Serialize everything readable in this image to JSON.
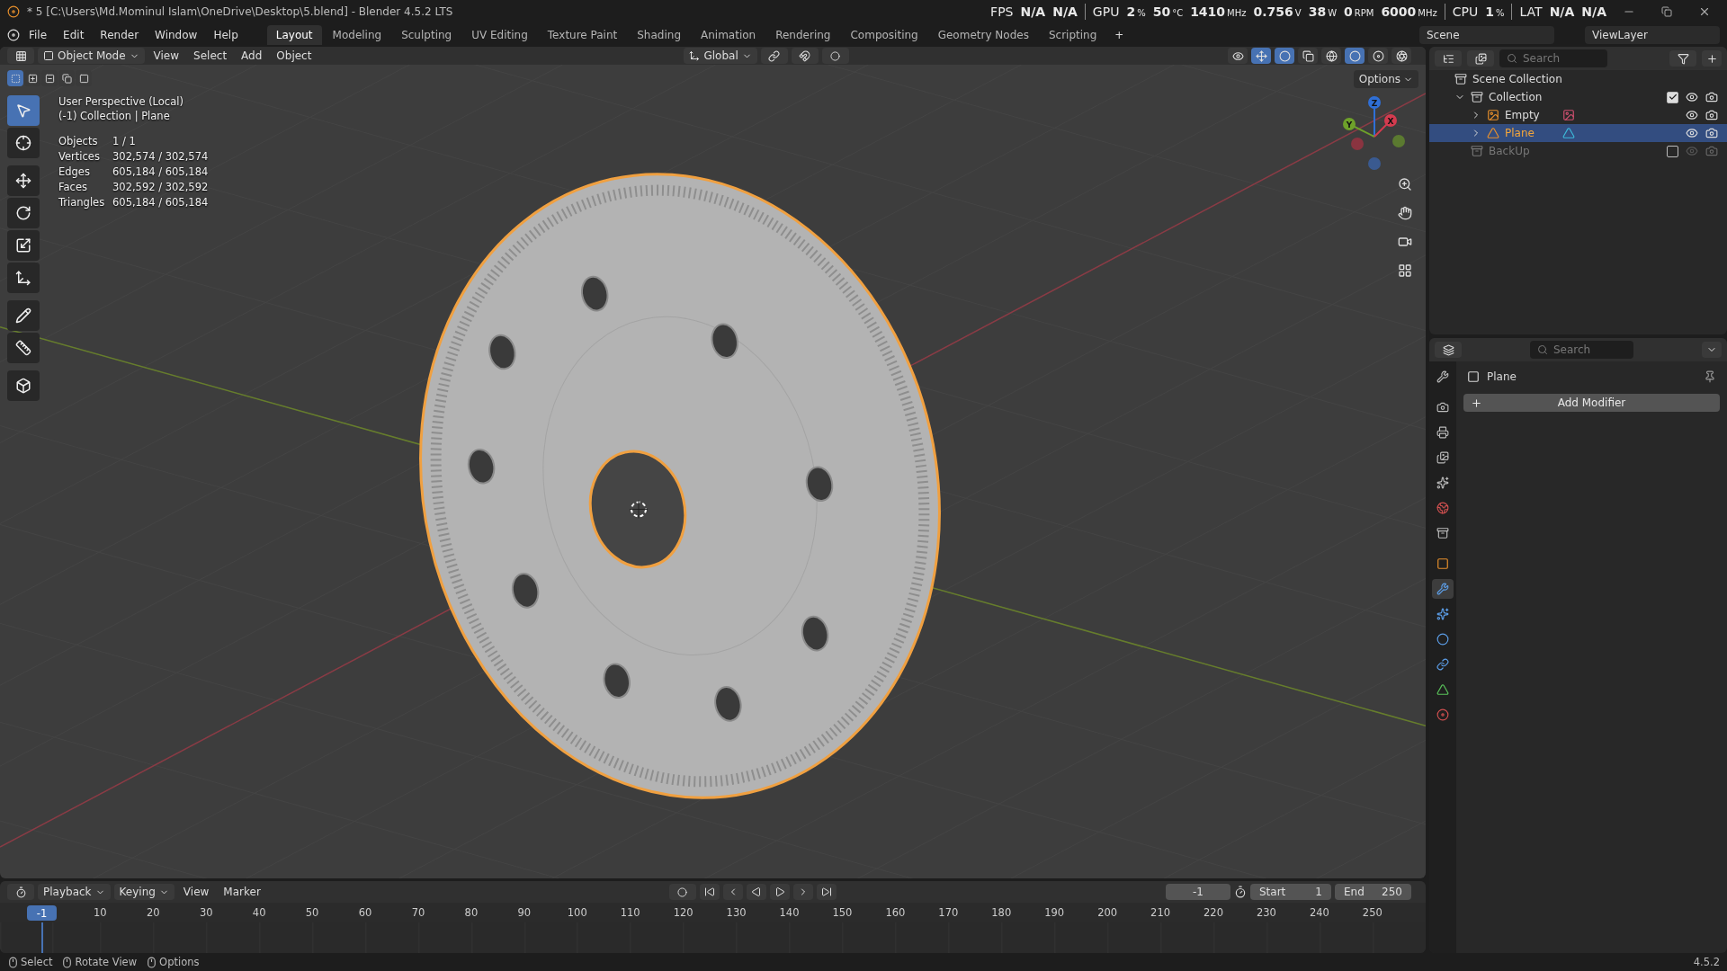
{
  "title_bar": {
    "title": "* 5 [C:\\Users\\Md.Mominul Islam\\OneDrive\\Desktop\\5.blend] - Blender 4.5.2 LTS"
  },
  "performance_overlay": [
    {
      "label": "FPS",
      "readings": [
        {
          "value": "N/A"
        },
        {
          "value": "N/A"
        }
      ]
    },
    {
      "label": "GPU",
      "readings": [
        {
          "value": "2",
          "unit": "%"
        },
        {
          "value": "50",
          "unit": "°C"
        },
        {
          "value": "1410",
          "unit": "MHz"
        },
        {
          "value": "0.756",
          "unit": "V"
        },
        {
          "value": "38",
          "unit": "W"
        },
        {
          "value": "0",
          "unit": "RPM"
        },
        {
          "value": "6000",
          "unit": "MHz"
        }
      ]
    },
    {
      "label": "CPU",
      "readings": [
        {
          "value": "1",
          "unit": "%"
        }
      ]
    },
    {
      "label": "LAT",
      "readings": [
        {
          "value": "N/A"
        },
        {
          "value": "N/A"
        }
      ]
    }
  ],
  "menu": [
    "File",
    "Edit",
    "Render",
    "Window",
    "Help"
  ],
  "workspace_tabs": [
    {
      "label": "Layout",
      "selected": true
    },
    {
      "label": "Modeling",
      "selected": false
    },
    {
      "label": "Sculpting",
      "selected": false
    },
    {
      "label": "UV Editing",
      "selected": false
    },
    {
      "label": "Texture Paint",
      "selected": false
    },
    {
      "label": "Shading",
      "selected": false
    },
    {
      "label": "Animation",
      "selected": false
    },
    {
      "label": "Rendering",
      "selected": false
    },
    {
      "label": "Compositing",
      "selected": false
    },
    {
      "label": "Geometry Nodes",
      "selected": false
    },
    {
      "label": "Scripting",
      "selected": false
    }
  ],
  "add_tab": "+",
  "scene_field": "Scene",
  "view_layer_field": "ViewLayer",
  "viewport": {
    "mode": "Object Mode",
    "menus": [
      "View",
      "Select",
      "Add",
      "Object"
    ],
    "orientation": "Global",
    "shading": [
      {
        "kind": "wireframe",
        "selected": false
      },
      {
        "kind": "solid",
        "selected": true
      },
      {
        "kind": "material",
        "selected": false
      },
      {
        "kind": "rendered",
        "selected": false
      }
    ],
    "select_modes": [
      {
        "kind": "new",
        "selected": true
      },
      {
        "kind": "extend",
        "selected": false
      },
      {
        "kind": "subtract",
        "selected": false
      },
      {
        "kind": "invert",
        "selected": false
      },
      {
        "kind": "intersect",
        "selected": false
      }
    ],
    "tools": [
      {
        "kind": "select",
        "selected": true
      },
      {
        "kind": "cursor",
        "selected": false
      },
      {
        "kind": "move",
        "selected": false
      },
      {
        "kind": "rotate",
        "selected": false
      },
      {
        "kind": "scale",
        "selected": false
      },
      {
        "kind": "transform",
        "selected": false
      },
      {
        "kind": "annotate",
        "selected": false
      },
      {
        "kind": "measure",
        "selected": false
      },
      {
        "kind": "add-cube",
        "selected": false
      }
    ],
    "options_button": "Options",
    "view_name": "User Perspective (Local)",
    "collection_line": "(-1) Collection | Plane",
    "stats": [
      {
        "label": "Objects",
        "value": "1 / 1"
      },
      {
        "label": "Vertices",
        "value": "302,574 / 302,574"
      },
      {
        "label": "Edges",
        "value": "605,184 / 605,184"
      },
      {
        "label": "Faces",
        "value": "302,592 / 302,592"
      },
      {
        "label": "Triangles",
        "value": "605,184 / 605,184"
      }
    ],
    "gizmo_axes": [
      {
        "label": "Z",
        "color": "#2f6fd6"
      },
      {
        "label": "Y",
        "color": "#6ea12a"
      },
      {
        "label": "X",
        "color": "#d43b4f"
      }
    ]
  },
  "outliner": {
    "search_placeholder": "Search",
    "tree": [
      {
        "label": "Scene Collection",
        "kind": "scene",
        "children": [
          {
            "label": "Collection",
            "kind": "collection",
            "expanded": true,
            "checked": true,
            "children": [
              {
                "label": "Empty",
                "kind": "empty",
                "expanded": false,
                "selected": false
              },
              {
                "label": "Plane",
                "kind": "mesh",
                "expanded": false,
                "selected": true
              }
            ]
          },
          {
            "label": "BackUp",
            "kind": "collection",
            "checked": false
          }
        ]
      }
    ]
  },
  "properties": {
    "search_placeholder": "Search",
    "object_name": "Plane",
    "add_modifier": "Add Modifier",
    "tabs": [
      {
        "kind": "tool",
        "selected": false
      },
      {
        "kind": "render",
        "selected": false
      },
      {
        "kind": "output",
        "selected": false
      },
      {
        "kind": "view-layer",
        "selected": false
      },
      {
        "kind": "scene",
        "selected": false
      },
      {
        "kind": "world",
        "selected": false
      },
      {
        "kind": "collection",
        "selected": false
      },
      {
        "kind": "object",
        "selected": false
      },
      {
        "kind": "modifiers",
        "selected": true
      },
      {
        "kind": "particles",
        "selected": false
      },
      {
        "kind": "physics",
        "selected": false
      },
      {
        "kind": "constraints",
        "selected": false
      },
      {
        "kind": "data",
        "selected": false
      },
      {
        "kind": "material",
        "selected": false
      }
    ]
  },
  "timeline": {
    "menus": [
      "Playback",
      "Keying",
      "View",
      "Marker"
    ],
    "current_frame": "-1",
    "start_label": "Start",
    "start": "1",
    "end_label": "End",
    "end": "250",
    "ruler_current": "-1",
    "ruler_ticks": [
      "10",
      "20",
      "30",
      "40",
      "50",
      "60",
      "70",
      "80",
      "90",
      "100",
      "110",
      "120",
      "130",
      "140",
      "150",
      "160",
      "170",
      "180",
      "190",
      "200",
      "210",
      "220",
      "230",
      "240",
      "250"
    ]
  },
  "status_bar": {
    "hints": [
      "Select",
      "Rotate View",
      "Options"
    ],
    "version": "4.5.2"
  }
}
